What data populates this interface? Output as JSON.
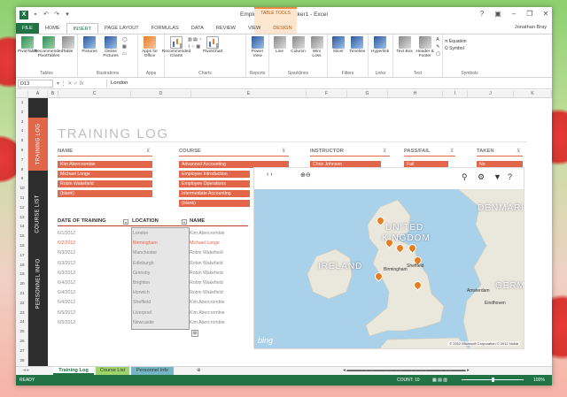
{
  "window": {
    "title": "Employee training tracker1 - Excel",
    "context_tab": "TABLE TOOLS"
  },
  "ribbon_tabs": [
    "FILE",
    "HOME",
    "INSERT",
    "PAGE LAYOUT",
    "FORMULAS",
    "DATA",
    "REVIEW",
    "VIEW",
    "DESIGN"
  ],
  "user": {
    "name": "Jonathan Bray"
  },
  "ribbon": {
    "group_names": [
      "Tables",
      "Illustrations",
      "Apps",
      "Charts",
      "Reports",
      "Sparklines",
      "Filters",
      "Links",
      "Text",
      "Symbols"
    ],
    "tables": [
      "PivotTable",
      "Recommended PivotTables",
      "Table"
    ],
    "illustrations": [
      "Pictures",
      "Online Pictures"
    ],
    "apps": [
      "Apps for Office"
    ],
    "charts": [
      "Recommended Charts",
      "PivotChart"
    ],
    "reports": [
      "Power View"
    ],
    "sparklines": [
      "Line",
      "Column",
      "Win/ Loss"
    ],
    "filters": [
      "Slicer",
      "Timeline"
    ],
    "links": [
      "Hyperlink"
    ],
    "text": [
      "Text Box",
      "Header & Footer"
    ],
    "symbols": [
      "Equation",
      "Symbol"
    ]
  },
  "formula_bar": {
    "cell_ref": "D13",
    "value": "London"
  },
  "columns": [
    "A",
    "B",
    "C",
    "D",
    "E",
    "F",
    "G",
    "H",
    "I",
    "J",
    "K"
  ],
  "rows": [
    "1",
    "2",
    "3",
    "4",
    "5",
    "6",
    "7",
    "8",
    "9",
    "10",
    "11",
    "12",
    "13",
    "14",
    "15",
    "16",
    "17",
    "18",
    "19",
    "20",
    "21",
    "22",
    "23",
    "24",
    "25",
    "26",
    "27",
    "28"
  ],
  "sidebar": [
    "TRAINING LOG",
    "COURSE LIST",
    "PERSONNEL INFO"
  ],
  "page": {
    "title": "TRAINING LOG"
  },
  "slicers": {
    "name": {
      "title": "NAME",
      "items": [
        "Kim Abercrombie",
        "Michael Longe",
        "Robin Wakefield",
        "(blank)"
      ]
    },
    "course": {
      "title": "COURSE",
      "items": [
        "Advanced Accounting",
        "Employee Introduction",
        "Employee Operations",
        "Intermediate Accounting",
        "(blank)"
      ]
    },
    "instructor": {
      "title": "INSTRUCTOR",
      "items": [
        "Chris Johnson"
      ]
    },
    "pass_fail": {
      "title": "PASS/FAIL",
      "items": [
        "Fail"
      ]
    },
    "taken": {
      "title": "TAKEN",
      "items": [
        "No"
      ]
    }
  },
  "table": {
    "headers": [
      "DATE OF TRAINING",
      "LOCATION",
      "NAME"
    ],
    "rows": [
      {
        "date": "6/1/2012",
        "location": "London",
        "name": "Kim Abercrombie",
        "highlight": false
      },
      {
        "date": "6/2/2012",
        "location": "Birmingham",
        "name": "Michael Longe",
        "highlight": true
      },
      {
        "date": "6/3/2012",
        "location": "Manchester",
        "name": "Robin Wakefield",
        "highlight": false
      },
      {
        "date": "6/3/2012",
        "location": "Edinburgh",
        "name": "Robin Wakefield",
        "highlight": false
      },
      {
        "date": "6/3/2012",
        "location": "Grimsby",
        "name": "Robin Wakefield",
        "highlight": false
      },
      {
        "date": "6/4/2012",
        "location": "Brighton",
        "name": "Robin Wakefield",
        "highlight": false
      },
      {
        "date": "6/4/2012",
        "location": "Horwich",
        "name": "Robin Wakefield",
        "highlight": false
      },
      {
        "date": "6/4/2012",
        "location": "Sheffield",
        "name": "Kim Abercrombie",
        "highlight": false
      },
      {
        "date": "6/5/2012",
        "location": "Liverpool",
        "name": "Kim Abercrombie",
        "highlight": false
      },
      {
        "date": "6/5/2012",
        "location": "Newcastle",
        "name": "Kim Abercrombie",
        "highlight": false
      }
    ]
  },
  "map": {
    "labels": [
      "UNITED",
      "KINGDOM",
      "IRELAND",
      "DENMARK",
      "GERMA"
    ],
    "cities": [
      "Sheffield",
      "Birmingham",
      "Amsterdam",
      "Eindhoven"
    ],
    "provider": "bing",
    "copyright": "© 2012 Microsoft Corporation © 2012 Nokia"
  },
  "sheet_tabs": [
    "Training Log",
    "Course List",
    "Personnel Info"
  ],
  "status": {
    "mode": "READY",
    "count": "COUNT: 10",
    "zoom_label": "100%",
    "zoom_fraction": 0.5
  }
}
